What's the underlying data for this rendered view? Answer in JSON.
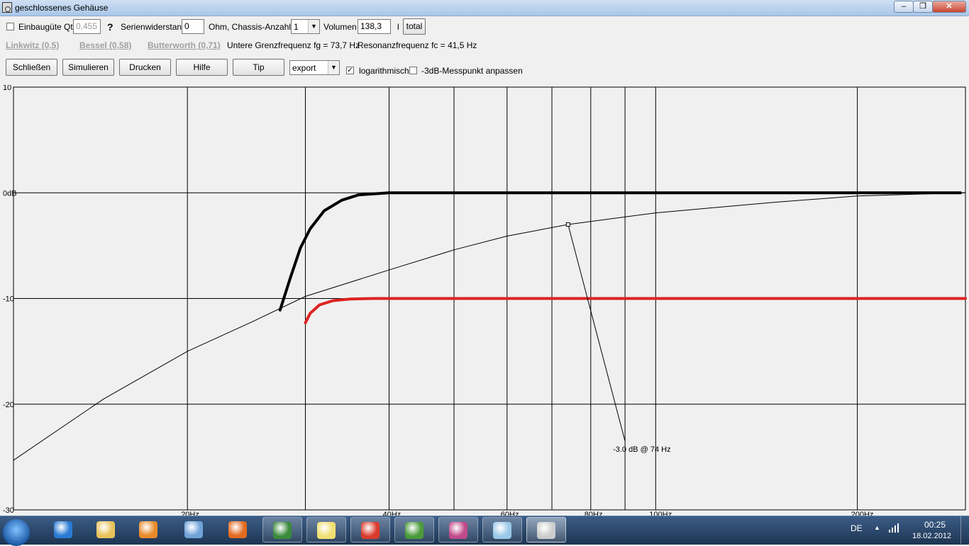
{
  "window": {
    "title": "geschlossenes Gehäuse"
  },
  "controls": {
    "einbaugute_label": "Einbaugüte Qtc",
    "einbaugute_value": "0,455",
    "help_mark": "?",
    "serienwiderstand_label": "Serienwiderstand",
    "serienwiderstand_value": "0",
    "ohm_label": "Ohm, Chassis-Anzahl",
    "chassis_value": "1",
    "volumen_label": "Volumen",
    "volumen_value": "138,3",
    "unit_l": "l",
    "total_label": "total"
  },
  "presets": {
    "linkwitz": "Linkwitz (0,5)",
    "bessel": "Bessel (0,58)",
    "butterworth": "Butterworth (0,71)"
  },
  "info": {
    "grenzfrequenz": "Untere Grenzfrequenz fg = 73,7 Hz",
    "resonanz": "Resonanzfrequenz fc = 41,5 Hz"
  },
  "buttons": {
    "schliessen": "Schließen",
    "simulieren": "Simulieren",
    "drucken": "Drucken",
    "hilfe": "Hilfe",
    "tip": "Tip"
  },
  "export_select": {
    "value": "export"
  },
  "options": {
    "logarithmisch_label": "logarithmisch",
    "logarithmisch_checked": true,
    "messpunkt_label": "-3dB-Messpunkt anpassen",
    "messpunkt_checked": false
  },
  "chart_data": {
    "type": "line",
    "xscale": "log",
    "xlim": [
      11,
      290
    ],
    "ylim": [
      -30,
      10
    ],
    "y_ticks": [
      10,
      0,
      -10,
      -20,
      -30
    ],
    "y_tick_labels": [
      "10",
      "0dB",
      "-10",
      "-20",
      "-30"
    ],
    "x_tick_labels": [
      {
        "x": 20,
        "label": "20Hz"
      },
      {
        "x": 40,
        "label": "40Hz"
      },
      {
        "x": 60,
        "label": "60Hz"
      },
      {
        "x": 80,
        "label": "80Hz"
      },
      {
        "x": 100,
        "label": "100Hz"
      },
      {
        "x": 200,
        "label": "200Hz"
      }
    ],
    "x_gridlines": [
      20,
      30,
      40,
      50,
      60,
      70,
      80,
      90,
      100,
      200
    ],
    "series": [
      {
        "color": "#000000",
        "style": "thin",
        "x": [
          11,
          15,
          20,
          25,
          30,
          40,
          50,
          60,
          74,
          100,
          150,
          200,
          290
        ],
        "y": [
          -25.3,
          -19.5,
          -15,
          -12.2,
          -9.8,
          -7.3,
          -5.4,
          -4.1,
          -3.0,
          -1.9,
          -0.9,
          -0.3,
          0
        ]
      },
      {
        "color": "#000000",
        "style": "thick",
        "x": [
          27.5,
          28.5,
          29.5,
          30.5,
          32,
          34,
          36,
          40,
          60,
          100,
          200,
          285
        ],
        "y": [
          -11.1,
          -8.0,
          -5.2,
          -3.4,
          -1.7,
          -0.7,
          -0.2,
          0,
          0,
          0,
          0,
          0
        ]
      },
      {
        "color": "#dd2222",
        "style": "thick",
        "x": [
          30,
          30.5,
          31.5,
          33,
          35,
          38,
          50,
          100,
          200,
          290
        ],
        "y": [
          -12.3,
          -11.4,
          -10.6,
          -10.2,
          -10.05,
          -10,
          -10,
          -10,
          -10,
          -10
        ]
      }
    ],
    "marker": {
      "x": 74,
      "y": -3.0
    },
    "annotation": {
      "text": "-3.0 dB @  74 Hz",
      "x": 90,
      "y": -23.5
    }
  },
  "taskbar": {
    "items": [
      {
        "name": "ie-icon",
        "color": "#2a7ad4",
        "state": "pinned"
      },
      {
        "name": "explorer-icon",
        "color": "#e8c35a",
        "state": "pinned"
      },
      {
        "name": "media-player-icon",
        "color": "#e98a2a",
        "state": "pinned"
      },
      {
        "name": "control-panel-icon",
        "color": "#6fa3d8",
        "state": "pinned"
      },
      {
        "name": "firefox-icon",
        "color": "#e26a1f",
        "state": "pinned"
      },
      {
        "name": "circuit-app-icon",
        "color": "#3a8a3a",
        "state": "running"
      },
      {
        "name": "notes-icon",
        "color": "#f0e070",
        "state": "running"
      },
      {
        "name": "chrome-icon",
        "color": "#d93b2b",
        "state": "running"
      },
      {
        "name": "globe-app-icon",
        "color": "#4a9a3a",
        "state": "running"
      },
      {
        "name": "3d-app-icon",
        "color": "#c04a8a",
        "state": "running"
      },
      {
        "name": "document-app-icon",
        "color": "#9ac8e8",
        "state": "running"
      },
      {
        "name": "speaker-app-icon",
        "color": "#cccccc",
        "state": "active"
      }
    ],
    "language": "DE",
    "time": "00:25",
    "date": "18.02.2012"
  }
}
